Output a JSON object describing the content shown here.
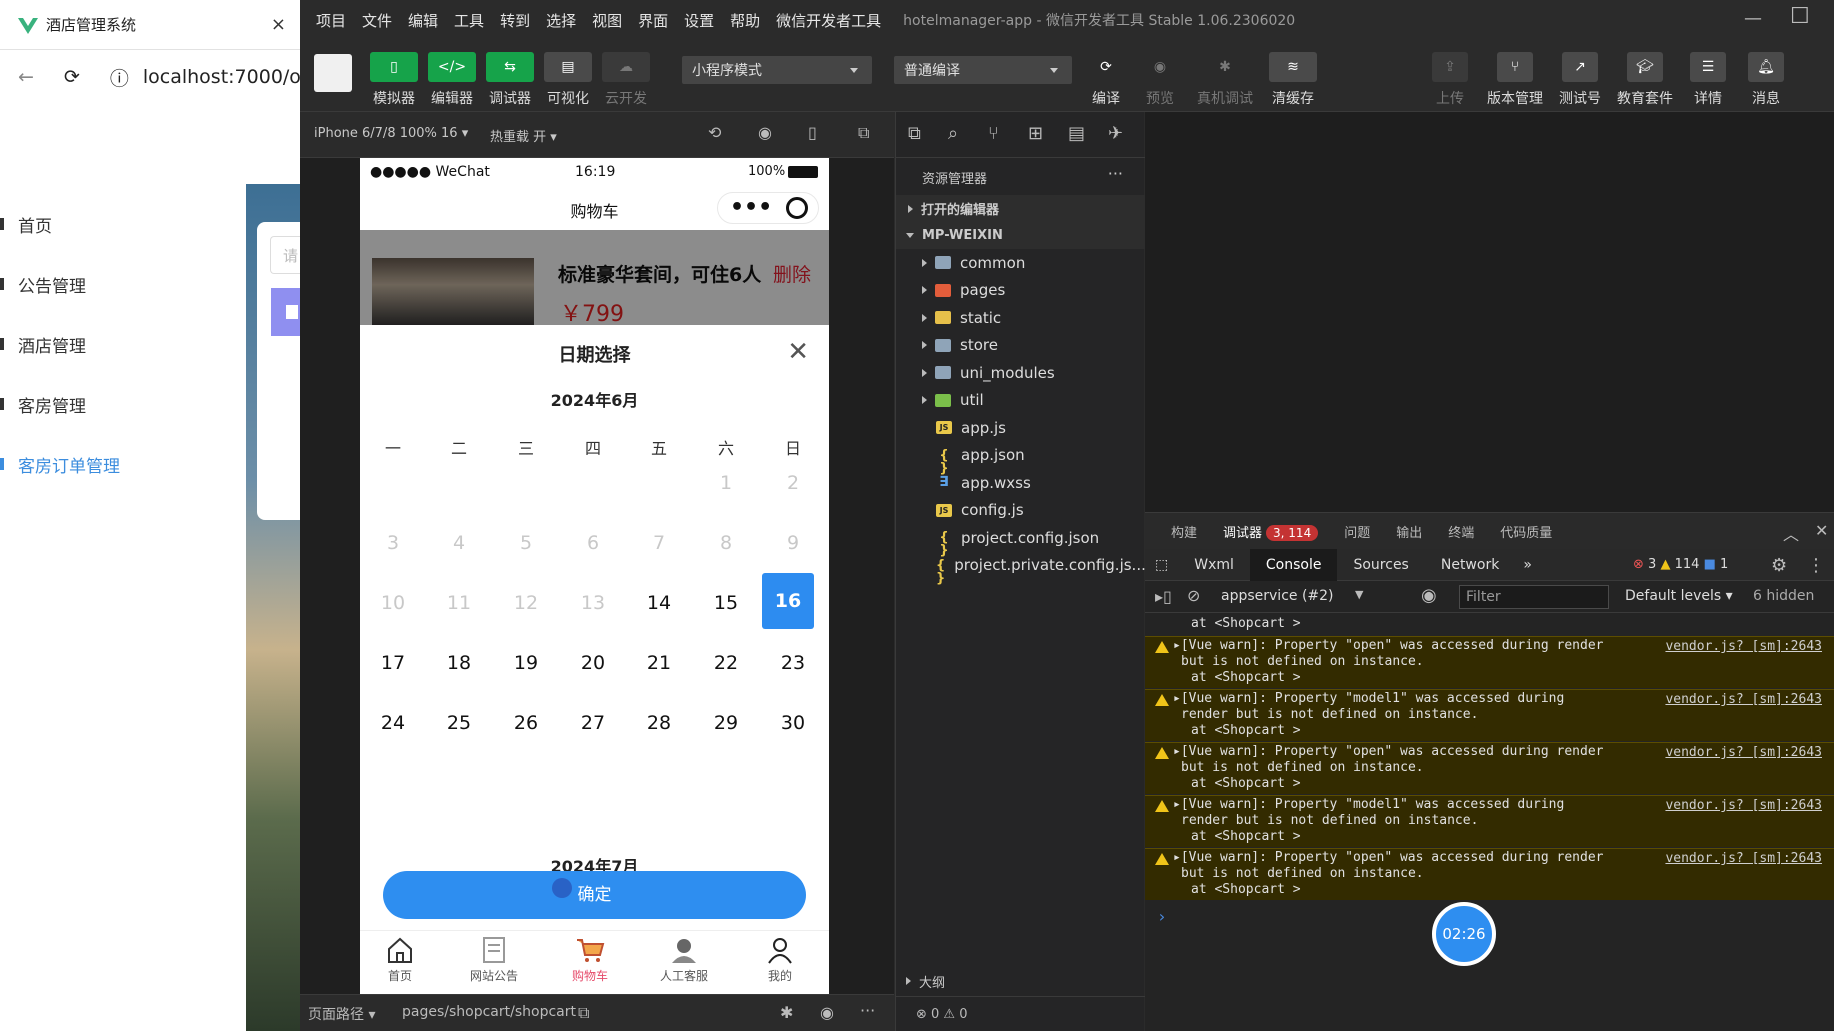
{
  "browser": {
    "tab_title": "酒店管理系统",
    "tab_close": "×",
    "url": "localhost:7000/or",
    "back": "←",
    "forward": "→",
    "reload": "⟳",
    "info": "ⓘ",
    "menu": [
      {
        "label": "首页"
      },
      {
        "label": "公告管理"
      },
      {
        "label": "酒店管理"
      },
      {
        "label": "客房管理"
      },
      {
        "label": "客房订单管理"
      }
    ],
    "partial_input": "请"
  },
  "devtools": {
    "menubar": [
      "项目",
      "文件",
      "编辑",
      "工具",
      "转到",
      "选择",
      "视图",
      "界面",
      "设置",
      "帮助",
      "微信开发者工具"
    ],
    "window_title": "hotelmanager-app - 微信开发者工具 Stable 1.06.2306020",
    "window_controls": {
      "minimize": "—",
      "maximize": "☐"
    },
    "toolbar": {
      "simulator": "模拟器",
      "editor": "编辑器",
      "debugger": "调试器",
      "visual": "可视化",
      "cloud": "云开发",
      "mode_select": "小程序模式",
      "compile_select": "普通编译",
      "compile": "编译",
      "preview": "预览",
      "real_debug": "真机调试",
      "clear_cache": "清缓存",
      "upload": "上传",
      "version_mgmt": "版本管理",
      "test_account": "测试号",
      "edu_kit": "教育套件",
      "details": "详情",
      "messages": "消息"
    },
    "sim_bar": {
      "device": "iPhone 6/7/8 100% 16 ▾",
      "hot_reload": "热重载 开 ▾"
    },
    "path_bar": {
      "label": "页面路径 ▾",
      "path": "pages/shopcart/shopcart"
    }
  },
  "phone": {
    "status": {
      "signal": "●●●●● WeChat",
      "time": "16:19",
      "battery": "100%"
    },
    "nav_title": "购物车",
    "capsule_dots": "•••",
    "cart_item": {
      "title": "标准豪华套间，可住6人",
      "delete": "删除",
      "price": "￥799"
    },
    "sheet": {
      "title": "日期选择",
      "close": "✕",
      "month1": "2024年6月",
      "month2": "2024年7月",
      "weekdays": [
        "一",
        "二",
        "三",
        "四",
        "五",
        "六",
        "日"
      ],
      "days": [
        {
          "d": "1",
          "state": "dis"
        },
        {
          "d": "2",
          "state": "dis"
        },
        {
          "d": "3",
          "state": "dis"
        },
        {
          "d": "4",
          "state": "dis"
        },
        {
          "d": "5",
          "state": "dis"
        },
        {
          "d": "6",
          "state": "dis"
        },
        {
          "d": "7",
          "state": "dis"
        },
        {
          "d": "8",
          "state": "dis"
        },
        {
          "d": "9",
          "state": "dis"
        },
        {
          "d": "10",
          "state": "dis"
        },
        {
          "d": "11",
          "state": "dis"
        },
        {
          "d": "12",
          "state": "dis"
        },
        {
          "d": "13",
          "state": "dis"
        },
        {
          "d": "14",
          "state": ""
        },
        {
          "d": "15",
          "state": ""
        },
        {
          "d": "16",
          "state": "sel"
        },
        {
          "d": "17",
          "state": ""
        },
        {
          "d": "18",
          "state": ""
        },
        {
          "d": "19",
          "state": ""
        },
        {
          "d": "20",
          "state": ""
        },
        {
          "d": "21",
          "state": ""
        },
        {
          "d": "22",
          "state": ""
        },
        {
          "d": "23",
          "state": ""
        },
        {
          "d": "24",
          "state": ""
        },
        {
          "d": "25",
          "state": ""
        },
        {
          "d": "26",
          "state": ""
        },
        {
          "d": "27",
          "state": ""
        },
        {
          "d": "28",
          "state": ""
        },
        {
          "d": "29",
          "state": ""
        },
        {
          "d": "30",
          "state": ""
        }
      ],
      "first_weekday_index": 5,
      "confirm": "确定"
    },
    "tabs": [
      {
        "label": "首页",
        "icon": "home-icon"
      },
      {
        "label": "网站公告",
        "icon": "notice-icon"
      },
      {
        "label": "购物车",
        "icon": "cart-icon",
        "active": true
      },
      {
        "label": "人工客服",
        "icon": "service-icon"
      },
      {
        "label": "我的",
        "icon": "user-icon"
      }
    ]
  },
  "explorer": {
    "title": "资源管理器",
    "more": "···",
    "open_editors": "打开的编辑器",
    "root": "MP-WEIXIN",
    "items": [
      {
        "name": "common",
        "type": "folder"
      },
      {
        "name": "pages",
        "type": "folder-red"
      },
      {
        "name": "static",
        "type": "folder-yellow"
      },
      {
        "name": "store",
        "type": "folder"
      },
      {
        "name": "uni_modules",
        "type": "folder"
      },
      {
        "name": "util",
        "type": "folder-green"
      },
      {
        "name": "app.js",
        "type": "js"
      },
      {
        "name": "app.json",
        "type": "json"
      },
      {
        "name": "app.wxss",
        "type": "wxss"
      },
      {
        "name": "config.js",
        "type": "js"
      },
      {
        "name": "project.config.json",
        "type": "json"
      },
      {
        "name": "project.private.config.js...",
        "type": "json"
      }
    ],
    "outline": "大纲",
    "status": "⊗ 0 ⚠ 0"
  },
  "panel": {
    "tabs": [
      "构建",
      "调试器",
      "问题",
      "输出",
      "终端",
      "代码质量"
    ],
    "debugger_badge": "3, 114",
    "devtabs": [
      "Wxml",
      "Console",
      "Sources",
      "Network",
      "»"
    ],
    "counts": {
      "errors": "3",
      "warnings": "114",
      "info": "1"
    },
    "context": "appservice (#2)",
    "filter_placeholder": "Filter",
    "levels": "Default levels ▾",
    "hidden": "6 hidden",
    "logs": [
      {
        "l1": "at <Shopcart >",
        "kind": "plain"
      },
      {
        "l1": "▸[Vue warn]: Property \"open\" was accessed during render",
        "l2": "but is not defined on instance.",
        "l3": "at <Shopcart >",
        "src": "vendor.js? [sm]:2643",
        "kind": "warn"
      },
      {
        "l1": "▸[Vue warn]: Property \"model1\" was accessed during",
        "l2": "render but is not defined on instance.",
        "l3": "at <Shopcart >",
        "src": "vendor.js? [sm]:2643",
        "kind": "warn"
      },
      {
        "l1": "▸[Vue warn]: Property \"open\" was accessed during render",
        "l2": "but is not defined on instance.",
        "l3": "at <Shopcart >",
        "src": "vendor.js? [sm]:2643",
        "kind": "warn"
      },
      {
        "l1": "▸[Vue warn]: Property \"model1\" was accessed during",
        "l2": "render but is not defined on instance.",
        "l3": "at <Shopcart >",
        "src": "vendor.js? [sm]:2643",
        "kind": "warn"
      },
      {
        "l1": "▸[Vue warn]: Property \"open\" was accessed during render",
        "l2": "but is not defined on instance.",
        "l3": "at <Shopcart >",
        "src": "vendor.js? [sm]:2643",
        "kind": "warn"
      }
    ],
    "prompt": "›"
  },
  "timer": "02:26"
}
